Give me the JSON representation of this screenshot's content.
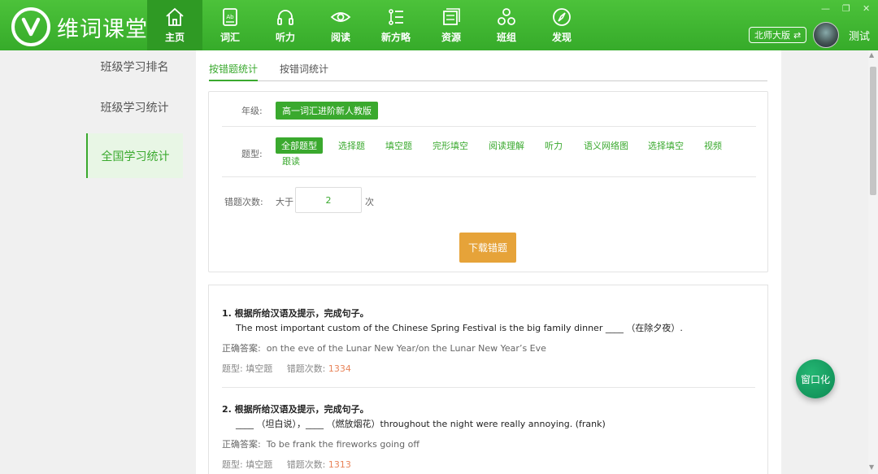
{
  "app": {
    "title": "维词课堂"
  },
  "nav": [
    {
      "label": "主页",
      "icon": "home-icon"
    },
    {
      "label": "词汇",
      "icon": "book-icon"
    },
    {
      "label": "听力",
      "icon": "headphones-icon"
    },
    {
      "label": "阅读",
      "icon": "eye-icon"
    },
    {
      "label": "新方略",
      "icon": "list-icon"
    },
    {
      "label": "资源",
      "icon": "resources-icon"
    },
    {
      "label": "班组",
      "icon": "group-icon"
    },
    {
      "label": "发现",
      "icon": "compass-icon"
    }
  ],
  "header": {
    "edition": "北师大版",
    "username": "测试"
  },
  "sidebar": {
    "items": [
      {
        "label": "班级学习排名"
      },
      {
        "label": "班级学习统计"
      },
      {
        "label": "全国学习统计"
      }
    ]
  },
  "tabs": [
    {
      "label": "按错题统计"
    },
    {
      "label": "按错词统计"
    }
  ],
  "filters": {
    "grade_label": "年级:",
    "grade_value": "高一词汇进阶新人教版",
    "type_label": "题型:",
    "types": [
      "全部题型",
      "选择题",
      "填空题",
      "完形填空",
      "阅读理解",
      "听力",
      "语义网络图",
      "选择填空",
      "视频",
      "跟读"
    ],
    "errors_label": "错题次数:",
    "errors_prefix": "大于",
    "errors_value": "2",
    "errors_suffix": "次",
    "download_label": "下载错题"
  },
  "questions": [
    {
      "title": "1.  根据所给汉语及提示，完成句子。",
      "text": "The most important custom of the Chinese Spring Festival is the big family dinner ____ （在除夕夜）.",
      "answer_label": "正确答案:",
      "answer": "on the eve of the Lunar New Year/on the Lunar New Year’s Eve",
      "type_text": "题型: 填空题",
      "count_label": "错题次数:",
      "count": "1334"
    },
    {
      "title": "2.  根据所给汉语及提示，完成句子。",
      "text": "____ （坦白说），____ （燃放烟花）throughout the night were really annoying. (frank)",
      "answer_label": "正确答案:",
      "answer": "To be frank    the fireworks going off",
      "type_text": "题型: 填空题",
      "count_label": "错题次数:",
      "count": "1313"
    }
  ],
  "float_button": {
    "label": "窗口化"
  },
  "colors": {
    "brand": "#3aa92e",
    "download": "#e6a339",
    "count": "#e8845a",
    "float": "#0d8a53"
  }
}
